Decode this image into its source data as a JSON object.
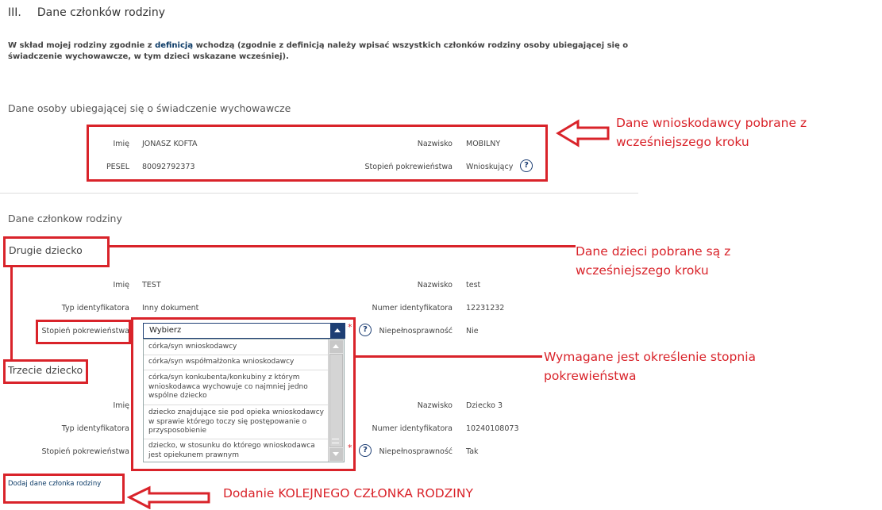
{
  "section": {
    "number": "III.",
    "title": "Dane członków rodziny"
  },
  "intro": {
    "before": "W skład mojej rodziny zgodnie z ",
    "link": "definicją",
    "after": " wchodzą (zgodnie z definicją należy wpisać wszystkich członków rodziny osoby ubiegającej się o świadczenie wychowawcze, w tym dzieci wskazane wcześniej)."
  },
  "applicant": {
    "heading": "Dane osoby ubiegającej się o świadczenie wychowawcze",
    "imie_label": "Imię",
    "imie": "JONASZ KOFTA",
    "nazwisko_label": "Nazwisko",
    "nazwisko": "MOBILNY",
    "pesel_label": "PESEL",
    "pesel": "80092792373",
    "stopien_label": "Stopień pokrewieństwa",
    "stopien": "Wnioskujący"
  },
  "family_heading": "Dane członkow rodziny",
  "child2": {
    "heading": "Drugie dziecko",
    "imie_label": "Imię",
    "imie": "TEST",
    "nazwisko_label": "Nazwisko",
    "nazwisko": "test",
    "typ_label": "Typ identyfikatora",
    "typ": "Inny dokument",
    "numer_label": "Numer identyfikatora",
    "numer": "12231232",
    "stopien_label": "Stopień pokrewieństwa",
    "select_value": "Wybierz",
    "niepelno_label": "Niepełnosprawność",
    "niepelno": "Nie"
  },
  "dropdown_options": [
    "córka/syn wnioskodawcy",
    "córka/syn współmałżonka wnioskodawcy",
    "córka/syn konkubenta/konkubiny z którym wnioskodawca wychowuje co najmniej jedno wspólne dziecko",
    "dziecko znajdujące sie pod opieka wnioskodawcy w sprawie którego toczy się postępowanie o przysposobienie",
    "dziecko, w stosunku do którego wnioskodawca jest opiekunem prawnym"
  ],
  "child3": {
    "heading": "Trzecie dziecko",
    "imie_label": "Imię",
    "nazwisko_label": "Nazwisko",
    "nazwisko": "Dziecko 3",
    "typ_label": "Typ identyfikatora",
    "numer_label": "Numer identyfikatora",
    "numer": "10240108073",
    "stopien_label": "Stopień pokrewieństwa",
    "niepelno_label": "Niepełnosprawność",
    "niepelno": "Tak"
  },
  "required_mark": "*",
  "help_symbol": "?",
  "add_member": "Dodaj dane członka rodziny",
  "annotations": {
    "a1": "Dane wnioskodawcy pobrane z wcześniejszego kroku",
    "a2": "Dane dzieci pobrane są z wcześniejszego kroku",
    "a3": "Wymagane jest określenie stopnia pokrewieństwa",
    "a4": "Dodanie KOLEJNEGO CZŁONKA RODZINY"
  },
  "colors": {
    "annotation_red": "#d9232a",
    "navy": "#1e3f74",
    "link": "#0b3a66"
  }
}
